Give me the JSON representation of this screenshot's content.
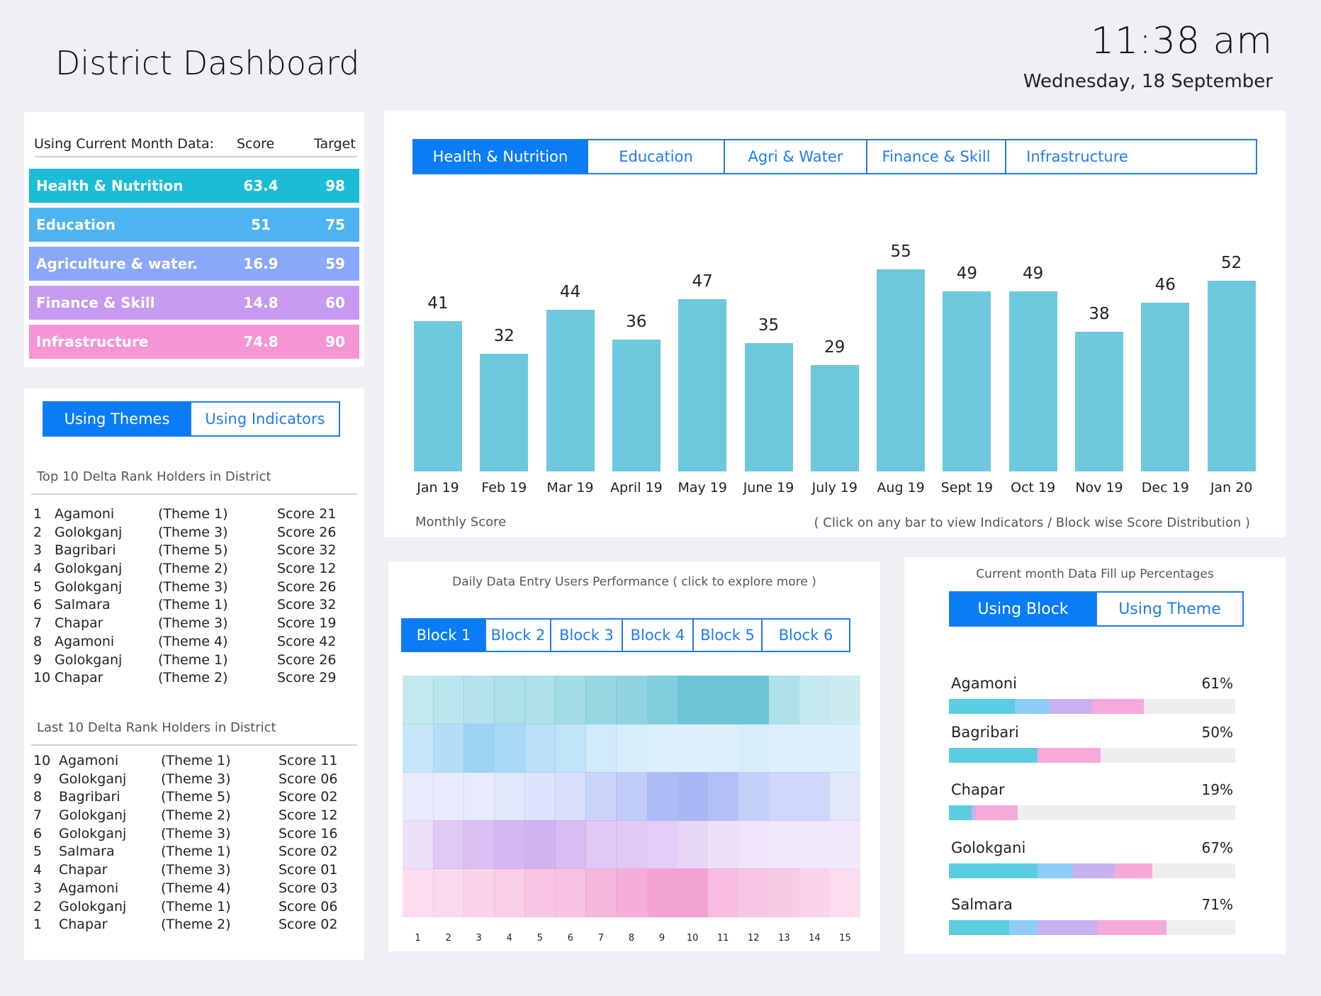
{
  "header": {
    "title": "District Dashboard",
    "time": "11:38 am",
    "date": "Wednesday, 18 September"
  },
  "colors": {
    "health": "#1bbcd6",
    "education": "#4db4f0",
    "agri": "#8aa8fa",
    "finance": "#c79af0",
    "infra": "#f595d4",
    "accent": "#0a7cf5",
    "bar": "#6dc8dd"
  },
  "scores": {
    "header": {
      "label": "Using Current Month Data:",
      "score": "Score",
      "target": "Target"
    },
    "rows": [
      {
        "name": "Health & Nutrition",
        "score": "63.4",
        "target": "98",
        "color": "#1bbcd6"
      },
      {
        "name": "Education",
        "score": "51",
        "target": "75",
        "color": "#4db4f0"
      },
      {
        "name": "Agriculture & water.",
        "score": "16.9",
        "target": "59",
        "color": "#8aa8fa"
      },
      {
        "name": "Finance & Skill",
        "score": "14.8",
        "target": "60",
        "color": "#c79af0"
      },
      {
        "name": "Infrastructure",
        "score": "74.8",
        "target": "90",
        "color": "#f595d4"
      }
    ]
  },
  "rank": {
    "tabs": [
      "Using Themes",
      "Using Indicators"
    ],
    "active_tab": 0,
    "top_title": "Top 10 Delta Rank Holders in District",
    "top": [
      {
        "rank": "1",
        "name": "Agamoni",
        "theme": "(Theme 1)",
        "score": "Score 21"
      },
      {
        "rank": "2",
        "name": "Golokganj",
        "theme": "(Theme 3)",
        "score": "Score 26"
      },
      {
        "rank": "3",
        "name": "Bagribari",
        "theme": "(Theme 5)",
        "score": "Score 32"
      },
      {
        "rank": "4",
        "name": "Golokganj",
        "theme": "(Theme 2)",
        "score": "Score 12"
      },
      {
        "rank": "5",
        "name": "Golokganj",
        "theme": "(Theme 3)",
        "score": "Score 26"
      },
      {
        "rank": "6",
        "name": "Salmara",
        "theme": "(Theme 1)",
        "score": "Score 32"
      },
      {
        "rank": "7",
        "name": "Chapar",
        "theme": "(Theme 3)",
        "score": "Score 19"
      },
      {
        "rank": "8",
        "name": "Agamoni",
        "theme": "(Theme 4)",
        "score": "Score 42"
      },
      {
        "rank": "9",
        "name": "Golokganj",
        "theme": "(Theme 1)",
        "score": "Score 26"
      },
      {
        "rank": "10",
        "name": "Chapar",
        "theme": "(Theme 2)",
        "score": "Score 29"
      }
    ],
    "last_title": "Last 10 Delta Rank Holders in District",
    "last": [
      {
        "rank": "10",
        "name": "Agamoni",
        "theme": "(Theme 1)",
        "score": "Score 11"
      },
      {
        "rank": "9",
        "name": "Golokganj",
        "theme": "(Theme 3)",
        "score": "Score 06"
      },
      {
        "rank": "8",
        "name": "Bagribari",
        "theme": "(Theme 5)",
        "score": "Score 02"
      },
      {
        "rank": "7",
        "name": "Golokganj",
        "theme": "(Theme 2)",
        "score": "Score 12"
      },
      {
        "rank": "6",
        "name": "Golokganj",
        "theme": "(Theme 3)",
        "score": "Score 16"
      },
      {
        "rank": "5",
        "name": "Salmara",
        "theme": "(Theme 1)",
        "score": "Score 02"
      },
      {
        "rank": "4",
        "name": "Chapar",
        "theme": "(Theme 3)",
        "score": "Score 01"
      },
      {
        "rank": "3",
        "name": "Agamoni",
        "theme": "(Theme 4)",
        "score": "Score 03"
      },
      {
        "rank": "2",
        "name": "Golokganj",
        "theme": "(Theme 1)",
        "score": "Score 06"
      },
      {
        "rank": "1",
        "name": "Chapar",
        "theme": "(Theme 2)",
        "score": "Score 02"
      }
    ]
  },
  "monthly": {
    "tabs": [
      "Health & Nutrition",
      "Education",
      "Agri & Water",
      "Finance & Skill",
      "Infrastructure"
    ],
    "active_tab": 0,
    "footer_left": "Monthly Score",
    "footer_right": "( Click on any bar to view Indicators / Block wise Score Distribution )"
  },
  "chart_data": {
    "type": "bar",
    "categories": [
      "Jan 19",
      "Feb 19",
      "Mar 19",
      "April 19",
      "May 19",
      "June 19",
      "July 19",
      "Aug 19",
      "Sept 19",
      "Oct 19",
      "Nov 19",
      "Dec 19",
      "Jan 20"
    ],
    "values": [
      41,
      32,
      44,
      36,
      47,
      35,
      29,
      55,
      49,
      49,
      38,
      46,
      52
    ],
    "value_labels": [
      "41",
      "32",
      "44",
      "36",
      "47",
      "35",
      "29",
      "55",
      "49",
      "49",
      "38",
      "46",
      "52"
    ],
    "title": "",
    "xlabel": "",
    "ylabel": "",
    "ylim": [
      0,
      55
    ],
    "grid": false,
    "color": "#6dc8dd"
  },
  "daily": {
    "title": "Daily Data Entry Users Performance ( click to explore more )",
    "tabs": [
      "Block 1",
      "Block 2",
      "Block 3",
      "Block 4",
      "Block 5",
      "Block 6"
    ],
    "active_tab": 0,
    "days": [
      "1",
      "2",
      "3",
      "4",
      "5",
      "6",
      "7",
      "8",
      "9",
      "10",
      "11",
      "12",
      "13",
      "14",
      "15"
    ],
    "row_colors": [
      "#6cc6d6",
      "#8ccdf2",
      "#9fb0f5",
      "#cba5ee",
      "#f39fd2"
    ],
    "intensity": [
      [
        0.4,
        0.45,
        0.5,
        0.55,
        0.55,
        0.62,
        0.7,
        0.75,
        0.85,
        1.0,
        1.0,
        1.0,
        0.55,
        0.4,
        0.35
      ],
      [
        0.5,
        0.65,
        0.85,
        0.75,
        0.6,
        0.55,
        0.4,
        0.35,
        0.3,
        0.3,
        0.3,
        0.35,
        0.3,
        0.3,
        0.3
      ],
      [
        0.25,
        0.25,
        0.25,
        0.3,
        0.35,
        0.4,
        0.55,
        0.65,
        0.85,
        0.9,
        0.8,
        0.6,
        0.5,
        0.5,
        0.3
      ],
      [
        0.35,
        0.6,
        0.7,
        0.8,
        0.85,
        0.75,
        0.6,
        0.6,
        0.55,
        0.45,
        0.35,
        0.3,
        0.25,
        0.25,
        0.25
      ],
      [
        0.35,
        0.4,
        0.45,
        0.5,
        0.6,
        0.65,
        0.75,
        0.85,
        0.95,
        0.95,
        0.7,
        0.6,
        0.55,
        0.45,
        0.35
      ]
    ]
  },
  "fillup": {
    "title": "Current month Data Fill up Percentages",
    "tabs": [
      "Using Block",
      "Using Theme"
    ],
    "active_tab": 0,
    "blocks": [
      {
        "name": "Agamoni",
        "pct": "61%",
        "segments": [
          {
            "color": "#5bcde0",
            "share": 0.23
          },
          {
            "color": "#8ccdf6",
            "share": 0.12
          },
          {
            "color": "#c8b1ef",
            "share": 0.15
          },
          {
            "color": "#f5aada",
            "share": 0.18
          }
        ]
      },
      {
        "name": "Bagribari",
        "pct": "50%",
        "segments": [
          {
            "color": "#5bcde0",
            "share": 0.31
          },
          {
            "color": "#f5aada",
            "share": 0.22
          }
        ]
      },
      {
        "name": "Chapar",
        "pct": "19%",
        "segments": [
          {
            "color": "#5bcde0",
            "share": 0.08
          },
          {
            "color": "#c8b1ef",
            "share": 0.015
          },
          {
            "color": "#f5aada",
            "share": 0.145
          }
        ]
      },
      {
        "name": "Golokgani",
        "pct": "67%",
        "segments": [
          {
            "color": "#5bcde0",
            "share": 0.31
          },
          {
            "color": "#8ccdf6",
            "share": 0.12
          },
          {
            "color": "#c8b1ef",
            "share": 0.15
          },
          {
            "color": "#f5aada",
            "share": 0.13
          }
        ]
      },
      {
        "name": "Salmara",
        "pct": "71%",
        "segments": [
          {
            "color": "#5bcde0",
            "share": 0.21
          },
          {
            "color": "#8ccdf6",
            "share": 0.1
          },
          {
            "color": "#c8b1ef",
            "share": 0.21
          },
          {
            "color": "#f5aada",
            "share": 0.24
          }
        ]
      }
    ]
  }
}
